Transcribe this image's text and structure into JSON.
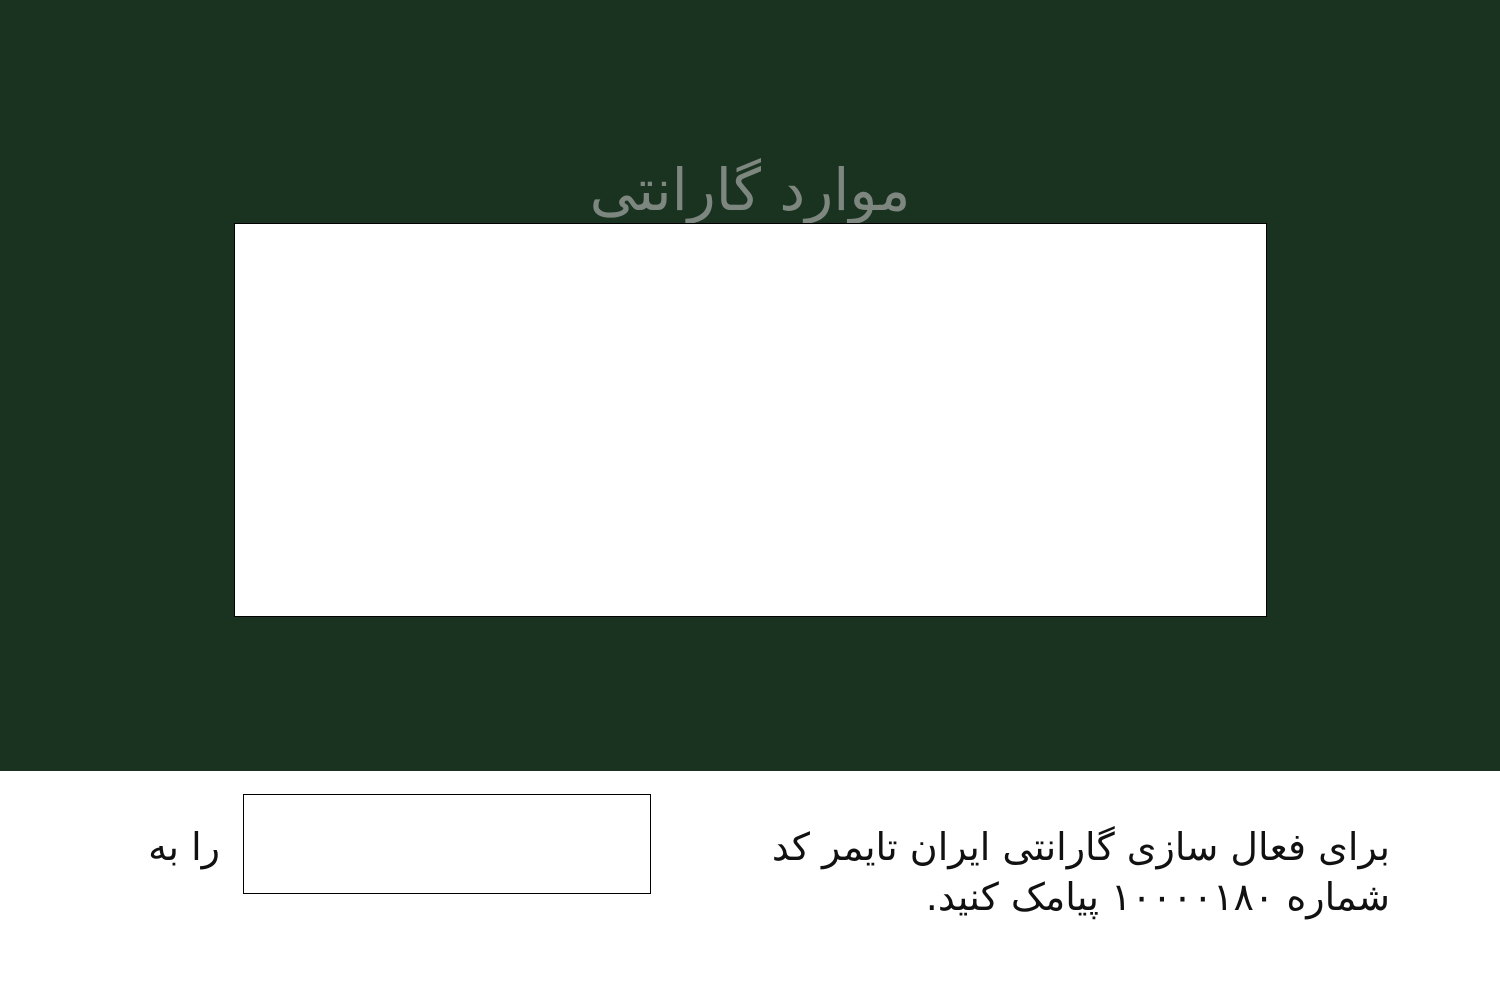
{
  "header": {
    "title": "موارد گارانتی"
  },
  "activation": {
    "line1": "برای فعال سازی گارانتی ایران تایمر کد",
    "line2": "شماره ۱۰۰۰۰۱۸۰ پیامک کنید.",
    "trailing": "را به",
    "code_value": ""
  },
  "colors": {
    "panel_background": "#1a3320",
    "title_color": "#7d877f"
  }
}
